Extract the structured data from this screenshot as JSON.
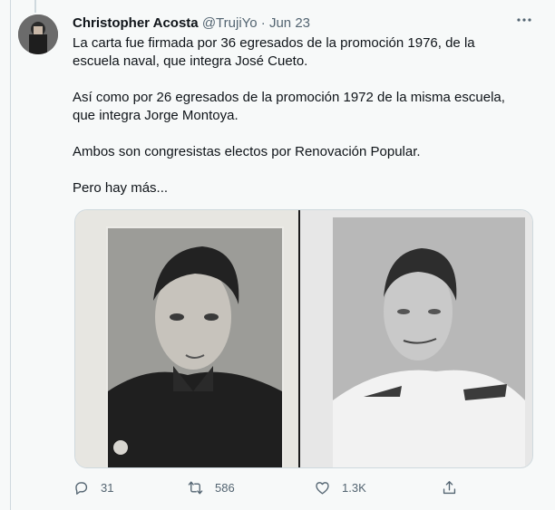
{
  "tweet": {
    "author_name": "Christopher Acosta",
    "handle": "@TrujiYo",
    "separator": "·",
    "date": "Jun 23",
    "more_icon": "more-horizontal-icon",
    "paragraphs": [
      "La carta fue firmada por 36 egresados de la promoción 1976, de la escuela naval, que integra José Cueto.",
      "Así como por 26 egresados de la promoción 1972 de la misma escuela, que integra Jorge Montoya.",
      "Ambos son congresistas electos por Renovación Popular.",
      "Pero hay más..."
    ],
    "media": {
      "left_photo": "black-and-white portrait of young naval officer",
      "right_photo": "black-and-white portrait of young naval officer in white uniform"
    },
    "actions": {
      "reply_count": "31",
      "retweet_count": "586",
      "like_count": "1.3K",
      "reply_icon": "reply-icon",
      "retweet_icon": "retweet-icon",
      "like_icon": "heart-icon",
      "share_icon": "share-icon"
    }
  },
  "colors": {
    "background": "#f7f9f9",
    "text": "#0f1419",
    "secondary": "#536471",
    "border": "#cfd9de"
  }
}
